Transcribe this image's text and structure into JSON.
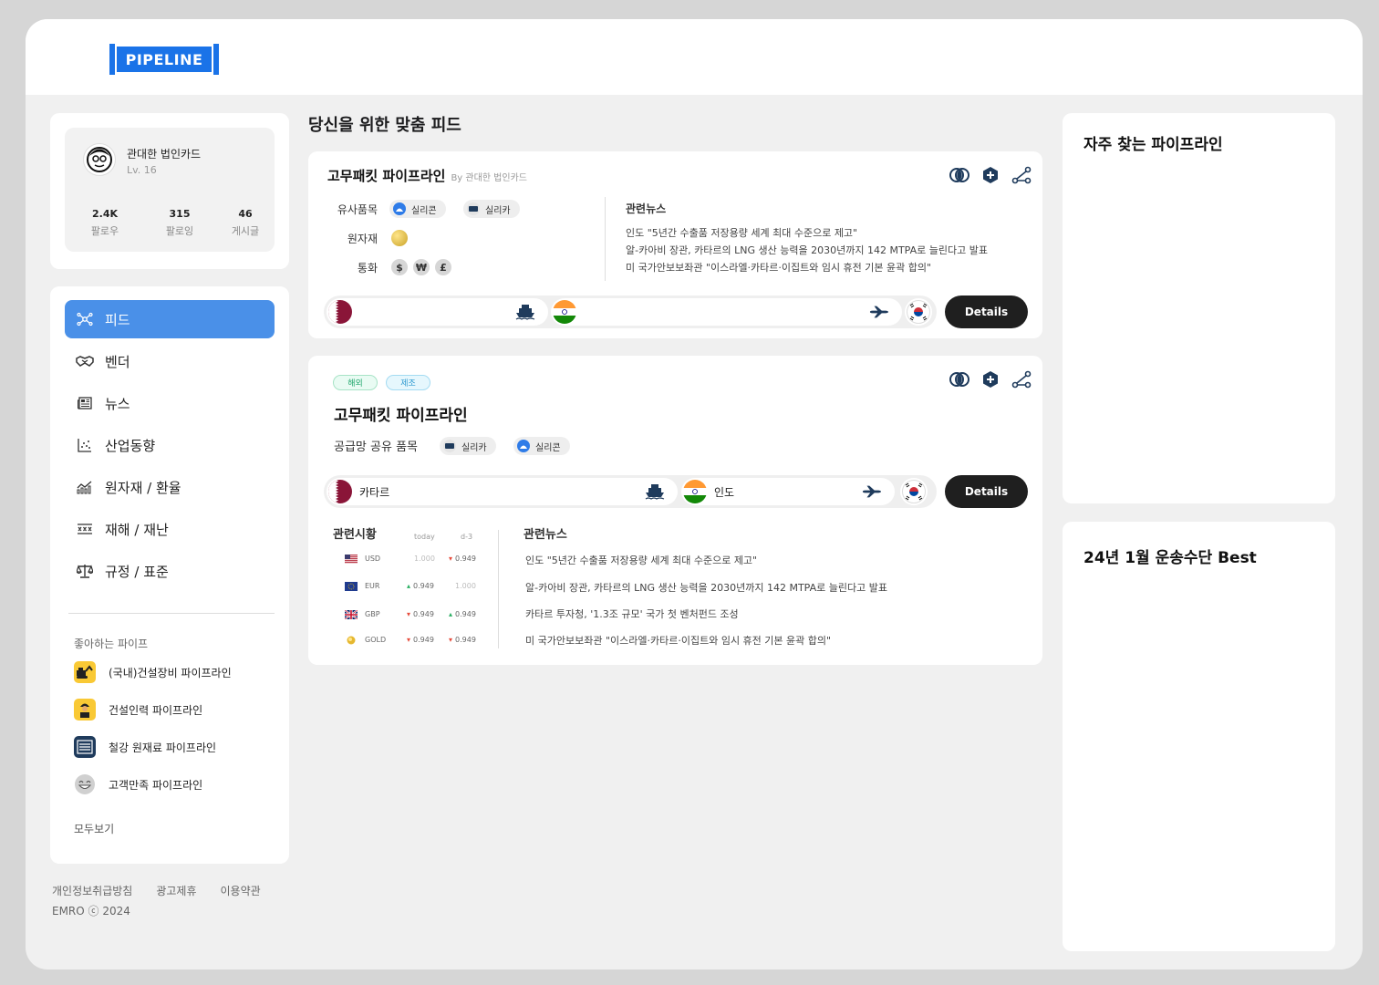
{
  "app": {
    "logo_text": "PIPELINE",
    "brand_color": "#1a73e8"
  },
  "profile": {
    "name": "관대한 법인카드",
    "level": "Lv. 16",
    "stats": [
      {
        "value": "2.4K",
        "label": "팔로우"
      },
      {
        "value": "315",
        "label": "팔로잉"
      },
      {
        "value": "46",
        "label": "게시글"
      }
    ]
  },
  "nav": {
    "items": [
      {
        "label": "피드",
        "icon": "network-icon",
        "active": true
      },
      {
        "label": "벤더",
        "icon": "handshake-icon"
      },
      {
        "label": "뉴스",
        "icon": "newspaper-icon"
      },
      {
        "label": "산업동향",
        "icon": "scatter-chart-icon"
      },
      {
        "label": "원자재 / 환율",
        "icon": "bar-chart-icon"
      },
      {
        "label": "재해 / 재난",
        "icon": "hazard-icon"
      },
      {
        "label": "규정 / 표준",
        "icon": "scale-icon"
      }
    ],
    "active_color": "#4a90e8",
    "favorites_title": "좋아하는 파이프",
    "favorites": [
      {
        "label": "(국내)건설장비 파이프라인",
        "icon": "excavator-icon"
      },
      {
        "label": "건설인력 파이프라인",
        "icon": "worker-icon"
      },
      {
        "label": "철강 원재료 파이프라인",
        "icon": "steel-icon"
      },
      {
        "label": "고객만족 파이프라인",
        "icon": "smile-icon"
      }
    ],
    "see_all": "모두보기"
  },
  "footer": {
    "links": [
      "개인정보취급방침",
      "광고제휴",
      "이용약관"
    ],
    "copyright": "EMRO ⓒ 2024"
  },
  "feed": {
    "title": "당신을 위한 맞춤 피드",
    "card1": {
      "title": "고무패킷 파이프라인",
      "by": "By 관대한 법인카드",
      "labels": {
        "similar": "유사품목",
        "raw": "원자재",
        "currency": "통화"
      },
      "similar_items": [
        "실리콘",
        "실리카"
      ],
      "currencies": [
        "$",
        "₩",
        "£"
      ],
      "news_title": "관련뉴스",
      "news": [
        "인도 \"5년간 수출품 저장용량 세계 최대 수준으로 제고\"",
        "알-카아비 장관, 카타르의 LNG 생산 능력을 2030년까지 142 MTPA로 늘린다고 발표",
        "미 국가안보보좌관 \"이스라엘·카타르·이집트와 임시 휴전 기본 윤곽 합의\""
      ],
      "details": "Details"
    },
    "card2": {
      "tags": [
        "해외",
        "제조"
      ],
      "title": "고무패킷 파이프라인",
      "shared_label": "공급망 공유 품목",
      "shared_items": [
        "실리카",
        "실리콘"
      ],
      "route": {
        "origin": "카타르",
        "mid": "인도"
      },
      "details": "Details",
      "market": {
        "title": "관련시황",
        "col_today": "today",
        "col_d3": "d-3",
        "rows": [
          {
            "code": "USD",
            "today": "1.000",
            "d3": "0.949",
            "today_dir": "flat",
            "d3_dir": "down"
          },
          {
            "code": "EUR",
            "today": "0.949",
            "d3": "1.000",
            "today_dir": "up",
            "d3_dir": "flat"
          },
          {
            "code": "GBP",
            "today": "0.949",
            "d3": "0.949",
            "today_dir": "down",
            "d3_dir": "up"
          },
          {
            "code": "GOLD",
            "today": "0.949",
            "d3": "0.949",
            "today_dir": "down",
            "d3_dir": "down"
          }
        ]
      },
      "news_title": "관련뉴스",
      "news": [
        "인도 \"5년간 수출품 저장용량 세계 최대 수준으로 제고\"",
        "알-카아비 장관, 카타르의 LNG 생산 능력을 2030년까지 142 MTPA로 늘린다고 발표",
        "카타르 투자청, '1.3조 규모' 국가 첫 벤처펀드 조성",
        "미 국가안보보좌관 \"이스라엘·카타르·이집트와 임시 휴전 기본 윤곽 합의\""
      ]
    }
  },
  "right": {
    "frequent_title": "자주 찾는 파이프라인",
    "best_title": "24년 1월 운송수단 Best"
  }
}
